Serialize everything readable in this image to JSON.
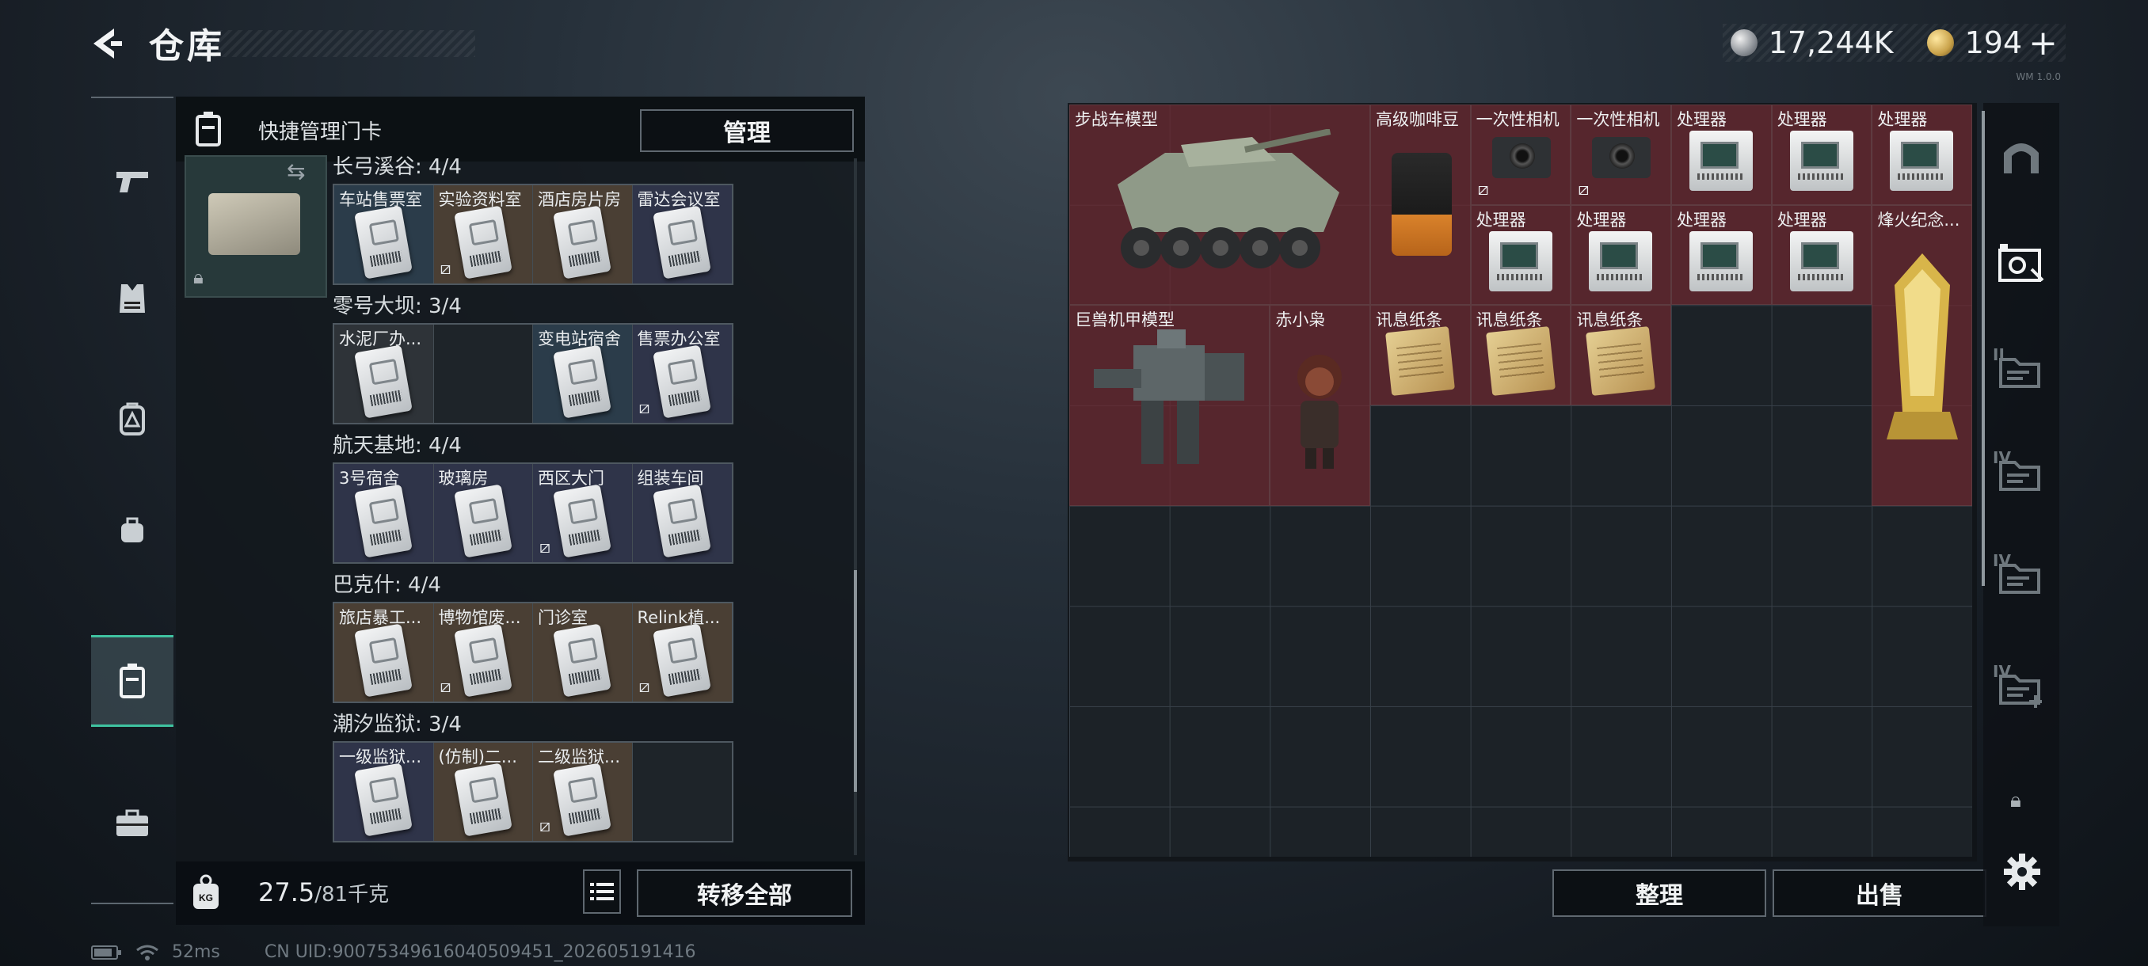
{
  "header": {
    "title": "仓库",
    "currency_silver": "17,244K",
    "currency_gold": "194",
    "currency_gold_plus": "+",
    "version": "WM 1.0.0"
  },
  "left_nav": {
    "items": [
      {
        "name": "weapons",
        "icon": "pistol-icon"
      },
      {
        "name": "armor",
        "icon": "vest-icon"
      },
      {
        "name": "backpack",
        "icon": "backpack-icon"
      },
      {
        "name": "bag",
        "icon": "small-bag-icon"
      },
      {
        "name": "keycard",
        "icon": "keycard-case-icon",
        "active": true
      },
      {
        "name": "toolbox",
        "icon": "toolbox-icon"
      }
    ]
  },
  "keycard_panel": {
    "header_label": "快捷管理门卡",
    "manage_button": "管理",
    "groups": [
      {
        "title": "长弓溪谷: 4/4",
        "cards": [
          {
            "label": "车站售票室",
            "bg": "blue",
            "unbound": false
          },
          {
            "label": "实验资料室",
            "bg": "brown",
            "unbound": true
          },
          {
            "label": "酒店房片房",
            "bg": "brown",
            "unbound": false
          },
          {
            "label": "雷达会议室",
            "bg": "navy",
            "unbound": false
          }
        ]
      },
      {
        "title": "零号大坝: 3/4",
        "cards": [
          {
            "label": "水泥厂办...",
            "bg": "grey",
            "unbound": false
          },
          {
            "label": "",
            "bg": "empty",
            "unbound": false,
            "empty": true
          },
          {
            "label": "变电站宿舍",
            "bg": "blue",
            "unbound": false
          },
          {
            "label": "售票办公室",
            "bg": "navy",
            "unbound": true
          }
        ]
      },
      {
        "title": "航天基地: 4/4",
        "cards": [
          {
            "label": "3号宿舍",
            "bg": "navy",
            "unbound": false
          },
          {
            "label": "玻璃房",
            "bg": "navy",
            "unbound": false
          },
          {
            "label": "西区大门",
            "bg": "navy",
            "unbound": true
          },
          {
            "label": "组装车间",
            "bg": "navy",
            "unbound": false
          }
        ]
      },
      {
        "title": "巴克什: 4/4",
        "cards": [
          {
            "label": "旅店暴工...",
            "bg": "brown",
            "unbound": false
          },
          {
            "label": "博物馆废...",
            "bg": "brown",
            "unbound": true
          },
          {
            "label": "门诊室",
            "bg": "brown",
            "unbound": false
          },
          {
            "label": "Relink植...",
            "bg": "brown",
            "unbound": true
          }
        ]
      },
      {
        "title": "潮汐监狱: 3/4",
        "cards": [
          {
            "label": "一级监狱...",
            "bg": "navy",
            "unbound": false
          },
          {
            "label": "(仿制)二...",
            "bg": "brown",
            "unbound": false
          },
          {
            "label": "二级监狱...",
            "bg": "brown",
            "unbound": true
          },
          {
            "label": "",
            "bg": "empty",
            "unbound": false,
            "empty": true
          }
        ]
      }
    ],
    "weight_value": "27.5",
    "weight_max": "/81千克",
    "transfer_all_button": "转移全部"
  },
  "status_bar": {
    "ping": "52ms",
    "uid": "CN UID:900753496160405094​51_202605191416"
  },
  "inventory": {
    "items": [
      {
        "label": "步战车模型",
        "art": "ifv-model",
        "unbound": false
      },
      {
        "label": "高级咖啡豆",
        "art": "coffee",
        "unbound": false
      },
      {
        "label": "一次性相机",
        "art": "camera",
        "unbound": true
      },
      {
        "label": "一次性相机",
        "art": "camera",
        "unbound": true
      },
      {
        "label": "处理器",
        "art": "cpu",
        "unbound": false
      },
      {
        "label": "处理器",
        "art": "cpu",
        "unbound": false
      },
      {
        "label": "处理器",
        "art": "cpu",
        "unbound": false
      },
      {
        "label": "处理器",
        "art": "cpu",
        "unbound": false
      },
      {
        "label": "处理器",
        "art": "cpu",
        "unbound": false
      },
      {
        "label": "处理器",
        "art": "cpu",
        "unbound": false
      },
      {
        "label": "处理器",
        "art": "cpu",
        "unbound": false
      },
      {
        "label": "烽火纪念...",
        "art": "trophy",
        "unbound": false
      },
      {
        "label": "巨兽机甲模型",
        "art": "mech-model",
        "unbound": false
      },
      {
        "label": "赤小枭",
        "art": "figure",
        "unbound": false
      },
      {
        "label": "讯息纸条",
        "art": "paper",
        "unbound": false
      },
      {
        "label": "讯息纸条",
        "art": "paper",
        "unbound": false
      },
      {
        "label": "讯息纸条",
        "art": "paper",
        "unbound": false
      }
    ],
    "sort_button": "整理",
    "sell_button": "出售"
  },
  "right_tabs": [
    {
      "name": "stash-tab-1",
      "icon": "arch-icon"
    },
    {
      "name": "stash-tab-2",
      "icon": "cabinet-photo-icon",
      "active": true
    },
    {
      "name": "stash-tab-3",
      "icon": "folder-ii-icon",
      "roman": "II"
    },
    {
      "name": "stash-tab-4",
      "icon": "folder-iv-icon",
      "roman": "IV"
    },
    {
      "name": "stash-tab-5",
      "icon": "folder-iv-icon",
      "roman": "IV"
    },
    {
      "name": "stash-tab-6",
      "icon": "folder-add-icon",
      "roman": "IV"
    }
  ],
  "colors": {
    "accent": "#3fc2a0",
    "item_bg": "#6e2830",
    "panel_bg": "#12171c"
  }
}
